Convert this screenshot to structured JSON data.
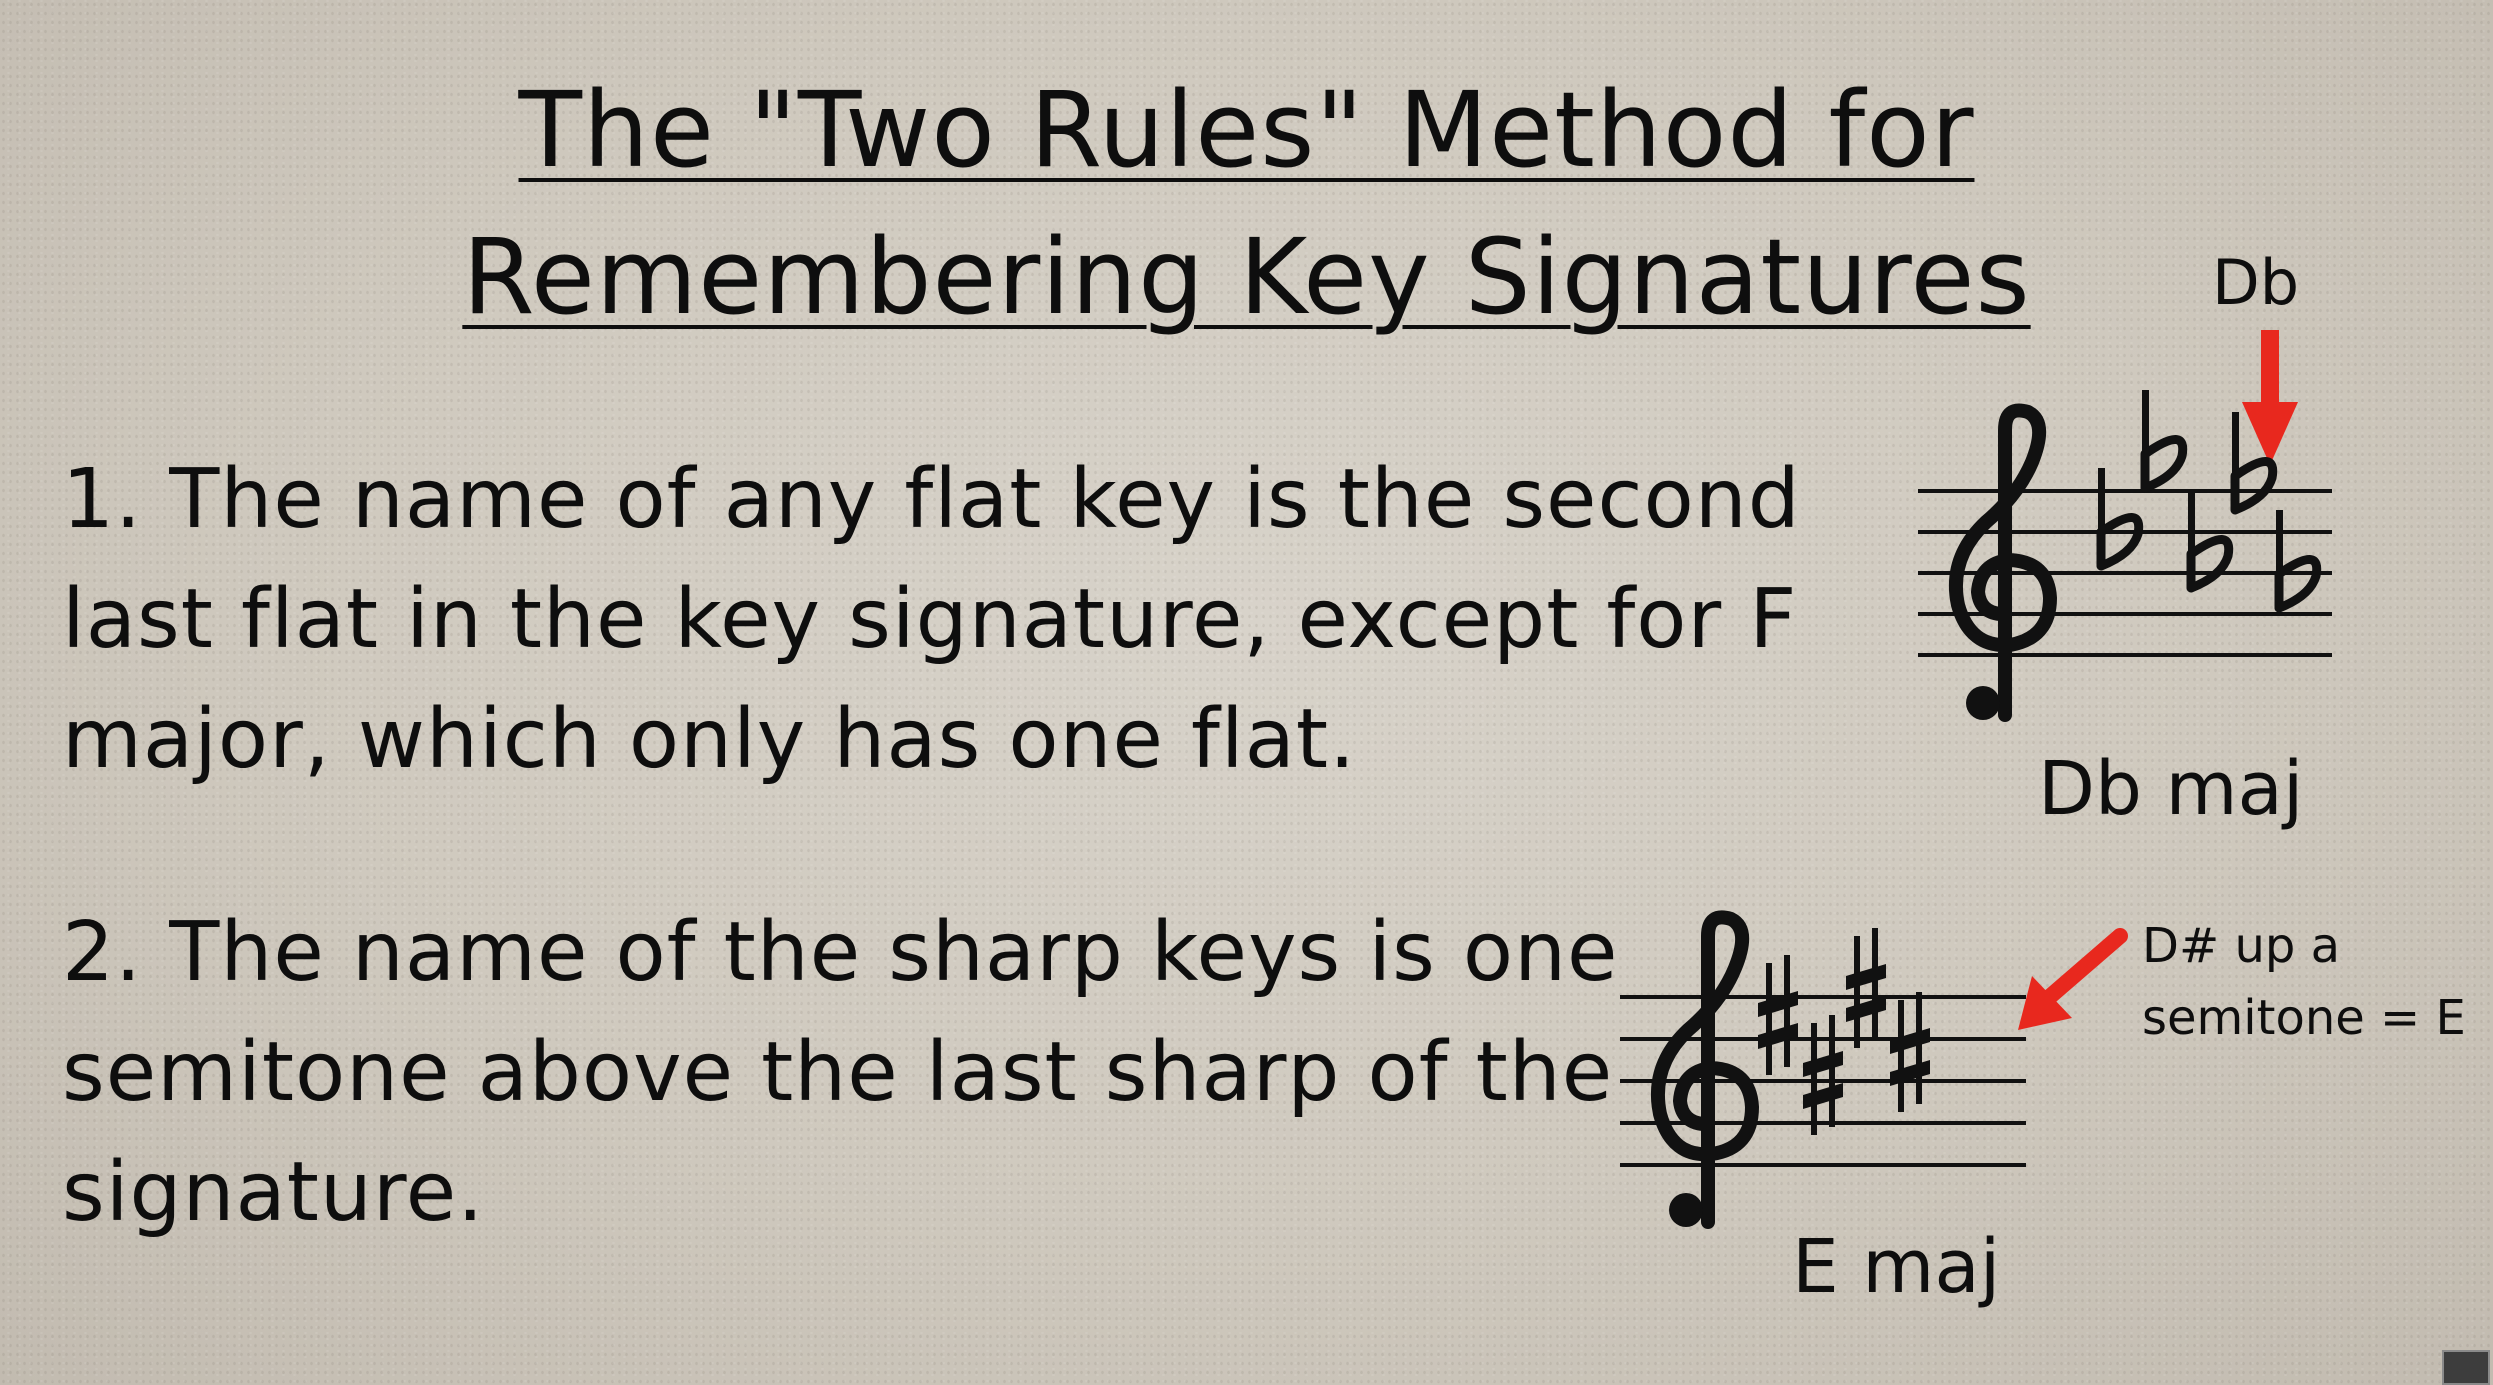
{
  "title": {
    "line1": "The \"Two Rules\" Method for",
    "line2": "Remembering Key Signatures"
  },
  "rules": [
    {
      "lines": [
        "1. The name of any flat key is the second",
        "last flat in the key signature, except for F",
        "major, which only has one flat."
      ]
    },
    {
      "lines": [
        "2.  The name of the sharp keys is one",
        "semitone above the last sharp of the",
        "signature."
      ]
    }
  ],
  "flat_example": {
    "pointer_label": "Db",
    "key_label": "Db maj",
    "accidental_count": 5
  },
  "sharp_example": {
    "note_line1": "D# up a",
    "note_line2": "semitone = E",
    "key_label": "E maj",
    "accidental_count": 4
  },
  "colors": {
    "text": "#0e0e0e",
    "arrow": "#e8281e"
  }
}
